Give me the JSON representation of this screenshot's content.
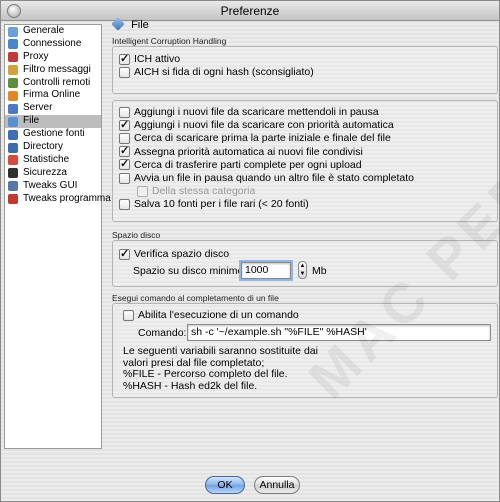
{
  "window": {
    "title": "Preferenze"
  },
  "sidebar": {
    "items": [
      {
        "label": "Generale",
        "icon": "general-icon",
        "color": "#6aa0d8"
      },
      {
        "label": "Connessione",
        "icon": "connection-icon",
        "color": "#4b86c8"
      },
      {
        "label": "Proxy",
        "icon": "proxy-icon",
        "color": "#c03a3a"
      },
      {
        "label": "Filtro messaggi",
        "icon": "filter-icon",
        "color": "#d0a23c"
      },
      {
        "label": "Controlli remoti",
        "icon": "remote-icon",
        "color": "#5f8f3e"
      },
      {
        "label": "Firma Online",
        "icon": "signature-icon",
        "color": "#e0872b"
      },
      {
        "label": "Server",
        "icon": "server-icon",
        "color": "#4c79c4"
      },
      {
        "label": "File",
        "icon": "file-icon",
        "color": "#5a8fd6",
        "selected": true
      },
      {
        "label": "Gestione fonti",
        "icon": "sources-icon",
        "color": "#3e6fb5"
      },
      {
        "label": "Directory",
        "icon": "directory-icon",
        "color": "#3b6ea8"
      },
      {
        "label": "Statistiche",
        "icon": "stats-icon",
        "color": "#d84b3b"
      },
      {
        "label": "Sicurezza",
        "icon": "security-icon",
        "color": "#2f2f2f"
      },
      {
        "label": "Tweaks GUI",
        "icon": "tweaks-gui-icon",
        "color": "#5577aa"
      },
      {
        "label": "Tweaks programma",
        "icon": "tweaks-program-icon",
        "color": "#c0392b"
      }
    ]
  },
  "header": {
    "title": "File"
  },
  "ich": {
    "section_label": "Intelligent Corruption Handling",
    "options": [
      {
        "label": "ICH attivo",
        "checked": true
      },
      {
        "label": "AICH si fida di ogni hash (sconsigliato)",
        "checked": false
      }
    ]
  },
  "download": {
    "options": [
      {
        "label": "Aggiungi i nuovi file da scaricare mettendoli in pausa",
        "checked": false
      },
      {
        "label": "Aggiungi i nuovi file da scaricare con priorità automatica",
        "checked": true
      },
      {
        "label": "Cerca di scaricare prima la parte iniziale e finale del file",
        "checked": false
      },
      {
        "label": "Assegna priorità automatica ai nuovi file condivisi",
        "checked": true
      },
      {
        "label": "Cerca di trasferire parti complete per ogni upload",
        "checked": true
      },
      {
        "label": "Avvia un file in pausa quando un altro file è stato completato",
        "checked": false
      },
      {
        "label": "Della stessa categoria",
        "checked": false,
        "disabled": true
      },
      {
        "label": "Salva 10 fonti per i file rari (< 20 fonti)",
        "checked": false
      }
    ]
  },
  "disk": {
    "section_label": "Spazio disco",
    "check_label": "Verifica spazio disco",
    "check_checked": true,
    "min_label": "Spazio su disco minimo:",
    "min_value": "1000",
    "unit": "Mb"
  },
  "command": {
    "section_label": "Esegui comando al completamento di un file",
    "enable_label": "Abilita l'esecuzione di un comando",
    "enable_checked": false,
    "cmd_label": "Comando:",
    "cmd_value": "sh -c '~/example.sh \"%FILE\" %HASH'",
    "help_lines": [
      "Le seguenti variabili saranno sostituite dai",
      "valori presi dal file completato;",
      "%FILE - Percorso completo del file.",
      "%HASH - Hash ed2k del file."
    ]
  },
  "footer": {
    "ok_label": "OK",
    "cancel_label": "Annulla"
  },
  "watermark": "MAC PEER"
}
